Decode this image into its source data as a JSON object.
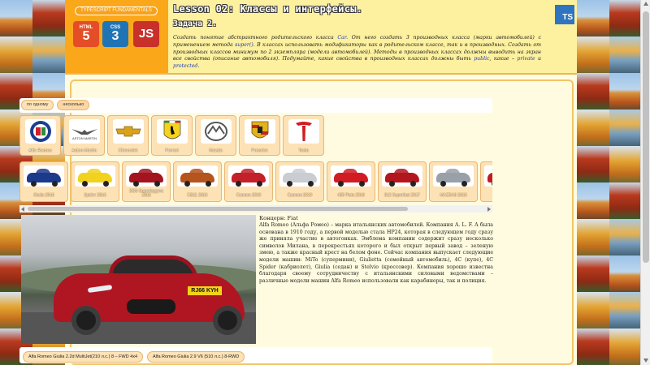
{
  "header": {
    "caption": "TYPESCRIPT FUNDAMENTALS",
    "tech_icons": [
      {
        "top": "HTML",
        "big": "5",
        "icon": "html5-icon"
      },
      {
        "top": "CSS",
        "big": "3",
        "icon": "css3-icon"
      },
      {
        "top": "",
        "big": "JS",
        "icon": "javascript-icon"
      }
    ],
    "lesson_title": "Lesson 02: Классы и интерфейсы.",
    "task_title": "Задача 2.",
    "task_text_1": "Создать понятие абстрактного родительского класса ",
    "task_code_1": "Car",
    "task_text_2": ". От него создать 3 производных класса (марки автомобилей) с применением метода ",
    "task_code_2": "super()",
    "task_text_3": ". В классах использовать модификаторы как в родительском классе, так и в производных. Создать от производных классов минимум по 2 экземпляра (модели автомобилей). Методы в производных классах должны выводить на экран все свойства (описание автомобиля). Подумайте, какие свойства в производных классах должны быть ",
    "task_code_3": "public",
    "task_text_4": ", какие – ",
    "task_code_4": "private",
    "task_text_5": " и ",
    "task_code_5": "protected",
    "task_text_6": ".",
    "ts_badge": "TS"
  },
  "toolbar": {
    "btn_1": "по одному",
    "btn_2": "несколько"
  },
  "brands": [
    {
      "name": "Alfa Romeo",
      "icon": "alfa-romeo-logo-icon"
    },
    {
      "name": "Aston Martin",
      "icon": "aston-martin-logo-icon"
    },
    {
      "name": "Chevrolet",
      "icon": "chevrolet-logo-icon"
    },
    {
      "name": "Ferrari",
      "icon": "ferrari-logo-icon"
    },
    {
      "name": "Mazda",
      "icon": "mazda-logo-icon"
    },
    {
      "name": "Porsche",
      "icon": "porsche-logo-icon"
    },
    {
      "name": "Tesla",
      "icon": "tesla-logo-icon"
    }
  ],
  "models": [
    {
      "name": "Giulia 2016",
      "color": "#1c3a8c"
    },
    {
      "name": "Spider 2016",
      "color": "#f1d21c"
    },
    {
      "name": "DBS Superleggera 2018",
      "color": "#a3141e"
    },
    {
      "name": "DB11 2016",
      "color": "#b5541c"
    },
    {
      "name": "Camaro 2019",
      "color": "#c3202a"
    },
    {
      "name": "Camaro 2019",
      "color": "#c9ccd1"
    },
    {
      "name": "488 Pista 2018",
      "color": "#d11c24"
    },
    {
      "name": "812 Superfast 2017",
      "color": "#b3161f"
    },
    {
      "name": "MAZDA6 2018",
      "color": "#9aa0a8"
    },
    {
      "name": "",
      "color": "#c21a22"
    }
  ],
  "details": {
    "title": "Концерн: Fiat",
    "text": "Alfa Romeo (Альфа Ромео) – марка итальянских автомобилей. Компания A. L. F. A была основана в 1910 году, а первой моделью стала HP24, которая в следующем году сразу же приняла участие в автогонках. Эмблема компании содержит сразу несколько символов Милана, в перекрестьях которого и был открыт первый завод – зеленую змею, а также красный крест на белом фоне. Сейчас компания выпускает следующие модели машин: MiTo (супермини), Giulietta (семейный автомобиль), 4C (купе), 4C Spider (кабриолет), Giulia (седан) и Stelvio (кроссовер). Компания хорошо известна благодаря своему сотрудничеству с итальянскими силовыми ведомствами – различные модели машин Alfa Romeo использовали как карабинеры, так и полиция.",
    "plate": "RJ66 KYH"
  },
  "engines": [
    "Alfa Romeo Giulia 2.2d MultiJet(210 л.с.) 8 – FWD 4x4",
    "Alfa Romeo Giulia 2.9 V6 (510 л.с.) 8-RWD"
  ]
}
